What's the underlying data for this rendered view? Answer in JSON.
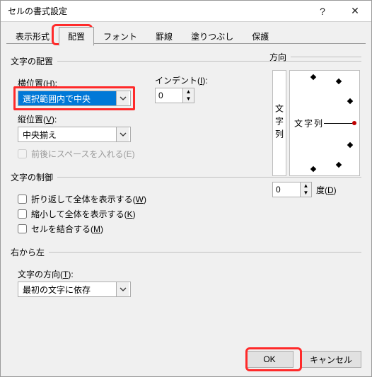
{
  "title": "セルの書式設定",
  "tabs": [
    "表示形式",
    "配置",
    "フォント",
    "罫線",
    "塗りつぶし",
    "保護"
  ],
  "active_tab_index": 1,
  "alignment": {
    "group_label": "文字の配置",
    "horizontal_label": "横位置(",
    "horizontal_key": "H",
    "horizontal_label2": "):",
    "horizontal_value": "選択範囲内で中央",
    "vertical_label": "縦位置(",
    "vertical_key": "V",
    "vertical_label2": "):",
    "vertical_value": "中央揃え",
    "indent_label": "インデント(",
    "indent_key": "I",
    "indent_label2": "):",
    "indent_value": "0",
    "distribute_label": "前後にスペースを入れる(",
    "distribute_key": "E",
    "distribute_label2": ")"
  },
  "control": {
    "group_label": "文字の制御",
    "wrap_label": "折り返して全体を表示する(",
    "wrap_key": "W",
    "wrap_label2": ")",
    "shrink_label": "縮小して全体を表示する(",
    "shrink_key": "K",
    "shrink_label2": ")",
    "merge_label": "セルを結合する(",
    "merge_key": "M",
    "merge_label2": ")"
  },
  "rtl": {
    "group_label": "右から左",
    "dir_label": "文字の方向(",
    "dir_key": "T",
    "dir_label2": "):",
    "dir_value": "最初の文字に依存"
  },
  "orientation": {
    "group_label": "方向",
    "vtext": "文字列",
    "htext": "文字列",
    "degree_value": "0",
    "degree_label": "度(",
    "degree_key": "D",
    "degree_label2": ")"
  },
  "buttons": {
    "ok": "OK",
    "cancel": "キャンセル"
  },
  "icons": {
    "help": "?",
    "close": "✕"
  }
}
